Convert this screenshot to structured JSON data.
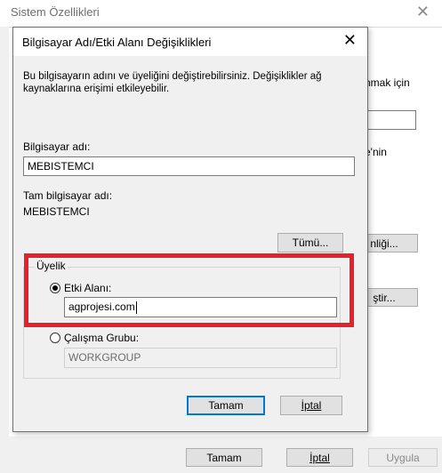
{
  "background_window": {
    "title": "Sistem Özellikleri",
    "close_glyph": "✕",
    "partial_text_1": "nmak için",
    "partial_text_2": "e'nin",
    "partial_button_1": "nliği...",
    "partial_button_2": "ştir...",
    "ok_label": "Tamam",
    "cancel_label": "İptal",
    "apply_label": "Uygula"
  },
  "dialog": {
    "title": "Bilgisayar Adı/Etki Alanı Değişiklikleri",
    "close_glyph": "✕",
    "description": "Bu bilgisayarın adını ve üyeliğini değiştirebilirsiniz. Değişiklikler ağ kaynaklarına erişimi etkileyebilir.",
    "computer_name_label": "Bilgisayar adı:",
    "computer_name_value": "MEBISTEMCI",
    "full_name_label": "Tam bilgisayar adı:",
    "full_name_value": "MEBISTEMCI",
    "more_button": "Tümü...",
    "membership": {
      "legend": "Üyelik",
      "domain_label": "Etki Alanı:",
      "domain_value": "agprojesi.com",
      "domain_selected": true,
      "workgroup_label": "Çalışma Grubu:",
      "workgroup_value": "WORKGROUP",
      "workgroup_selected": false
    },
    "ok_label": "Tamam",
    "cancel_label": "İptal"
  },
  "colors": {
    "highlight": "#e8202a",
    "focus": "#0078d7"
  }
}
